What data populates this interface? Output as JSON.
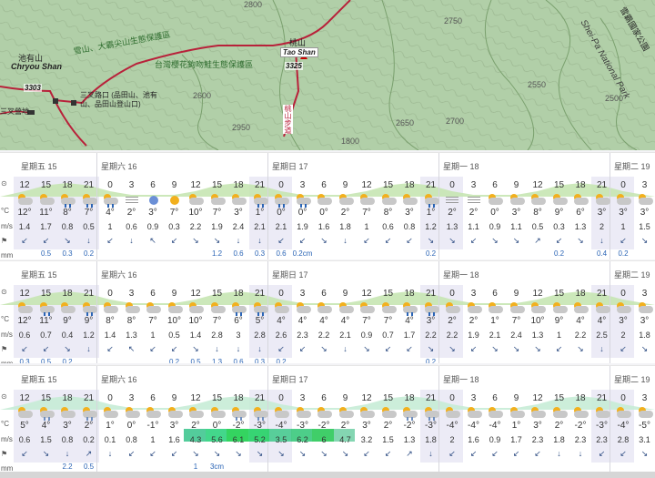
{
  "map": {
    "labels": {
      "chiyou_cn": "池有山",
      "chiyou_en": "Chryou Shan",
      "chiyou_height": "3303",
      "tao_cn": "桃山",
      "tao_en": "Tao Shan",
      "tao_height": "3325",
      "reserve1": "雪山、大霸尖山生態保護區",
      "reserve2": "台灣櫻花鉤吻鮭生態保護區",
      "junction": "三叉路口 (品田山、池有山、品田山登山口)",
      "camp": "三叉營地",
      "road": "桃山步道",
      "park": "Shei-Pa National Park",
      "park_cn": "雪霸國家公園"
    },
    "contours": [
      "1800",
      "2950",
      "2650",
      "2700",
      "2550",
      "2500",
      "2600",
      "2750",
      "2800"
    ]
  },
  "bands": [
    {
      "days": [
        "星期五 15",
        "星期六 16",
        "星期日 17",
        "星期一 18",
        "星期二 19"
      ],
      "hours": [
        "12",
        "15",
        "18",
        "21",
        "0",
        "3",
        "6",
        "9",
        "12",
        "15",
        "18",
        "21",
        "0",
        "3",
        "6",
        "9",
        "12",
        "15",
        "18",
        "21",
        "0",
        "3",
        "6",
        "9",
        "12",
        "15",
        "18",
        "21",
        "0",
        "3"
      ],
      "temps": [
        "12°",
        "11°",
        "8°",
        "7°",
        "4°",
        "2°",
        "3°",
        "7°",
        "10°",
        "7°",
        "3°",
        "1°",
        "0°",
        "0°",
        "0°",
        "2°",
        "7°",
        "8°",
        "3°",
        "1°",
        "2°",
        "2°",
        "0°",
        "3°",
        "8°",
        "9°",
        "6°",
        "3°",
        "3°",
        "3°"
      ],
      "winds": [
        "1.4",
        "1.7",
        "0.8",
        "0.5",
        "1",
        "0.6",
        "0.9",
        "0.3",
        "2.2",
        "1.9",
        "2.4",
        "2.1",
        "2.1",
        "1.9",
        "1.6",
        "1.8",
        "1",
        "0.6",
        "0.8",
        "1.2",
        "1.3",
        "1.1",
        "0.9",
        "1.1",
        "0.5",
        "0.3",
        "1.3",
        "2",
        "1",
        "1.5"
      ],
      "precip": [
        "",
        "0.5",
        "0.3",
        "0.2",
        "",
        "",
        "",
        "",
        "",
        "1.2",
        "0.6",
        "0.3",
        "0.6",
        "0.2cm",
        "",
        "",
        "",
        "",
        "",
        "0.2",
        "",
        "",
        "",
        "",
        "",
        "0.2",
        "",
        "0.4",
        "0.2",
        ""
      ],
      "wind_arrows": [
        "↙",
        "↙",
        "↘",
        "↓",
        "↙",
        "↓",
        "↖",
        "↙",
        "↘",
        "↘",
        "↓",
        "↓",
        "↙",
        "↙",
        "↘",
        "↓",
        "↙",
        "↙",
        "↙",
        "↘",
        "↘",
        "↙",
        "↘",
        "↘",
        "↗",
        "↙",
        "↘",
        "↓",
        "↙",
        "↘"
      ],
      "icons": [
        "pc",
        "pc",
        "rain",
        "rain",
        "rain",
        "fog",
        "moon",
        "sun",
        "pc",
        "pc",
        "pc",
        "rain",
        "rain",
        "rain",
        "pc",
        "pc",
        "pc",
        "pc",
        "pc",
        "rain",
        "fog",
        "fog",
        "pc",
        "pc",
        "pc",
        "pc",
        "pc",
        "pc",
        "pc",
        "pc"
      ]
    },
    {
      "days": [
        "星期五 15",
        "星期六 16",
        "星期日 17",
        "星期一 18",
        "星期二 19"
      ],
      "hours": [
        "12",
        "15",
        "18",
        "21",
        "0",
        "3",
        "6",
        "9",
        "12",
        "15",
        "18",
        "21",
        "0",
        "3",
        "6",
        "9",
        "12",
        "15",
        "18",
        "21",
        "0",
        "3",
        "6",
        "9",
        "12",
        "15",
        "18",
        "21",
        "0",
        "3"
      ],
      "temps": [
        "12°",
        "11°",
        "9°",
        "9°",
        "8°",
        "8°",
        "7°",
        "10°",
        "10°",
        "7°",
        "6°",
        "5°",
        "4°",
        "4°",
        "4°",
        "4°",
        "7°",
        "7°",
        "4°",
        "3°",
        "2°",
        "2°",
        "1°",
        "7°",
        "10°",
        "9°",
        "4°",
        "4°",
        "3°",
        "3°"
      ],
      "winds": [
        "0.6",
        "0.7",
        "0.4",
        "1.2",
        "1.4",
        "1.3",
        "1",
        "0.5",
        "1.4",
        "2.8",
        "3",
        "2.8",
        "2.6",
        "2.3",
        "2.2",
        "2.1",
        "0.9",
        "0.7",
        "1.7",
        "2.2",
        "2.2",
        "1.9",
        "2.1",
        "2.4",
        "1.3",
        "1",
        "2.2",
        "2.5",
        "2",
        "1.8"
      ],
      "precip": [
        "0.3",
        "0.5",
        "0.2",
        "",
        "",
        "",
        "",
        "0.2",
        "0.5",
        "1.3",
        "0.6",
        "0.3",
        "0.2",
        "",
        "",
        "",
        "",
        "",
        "",
        "0.2",
        "",
        "",
        "",
        "",
        "",
        "",
        "",
        "",
        "",
        ""
      ],
      "wind_arrows": [
        "↙",
        "↙",
        "↘",
        "↓",
        "↙",
        "↖",
        "↙",
        "↙",
        "↘",
        "↓",
        "↓",
        "↓",
        "↙",
        "↙",
        "↘",
        "↓",
        "↘",
        "↙",
        "↙",
        "↘",
        "↘",
        "↙",
        "↘",
        "↘",
        "↘",
        "↙",
        "↘",
        "↓",
        "↙",
        "↘"
      ],
      "icons": [
        "pc",
        "rain",
        "pc",
        "rain",
        "pc",
        "pc",
        "pc",
        "pc",
        "pc",
        "pc",
        "rain",
        "rain",
        "pc",
        "pc",
        "pc",
        "pc",
        "pc",
        "pc",
        "rain",
        "rain",
        "pc",
        "pc",
        "pc",
        "pc",
        "pc",
        "pc",
        "pc",
        "pc",
        "pc",
        "pc"
      ]
    },
    {
      "days": [
        "星期五 15",
        "星期六 16",
        "星期日 17",
        "星期一 18",
        "星期二 19"
      ],
      "hours": [
        "12",
        "15",
        "18",
        "21",
        "0",
        "3",
        "6",
        "9",
        "12",
        "15",
        "18",
        "21",
        "0",
        "3",
        "6",
        "9",
        "12",
        "15",
        "18",
        "21",
        "0",
        "3",
        "6",
        "9",
        "12",
        "15",
        "18",
        "21",
        "0",
        "3"
      ],
      "temps": [
        "5°",
        "4°",
        "3°",
        "2°",
        "1°",
        "0°",
        "-1°",
        "3°",
        "2°",
        "0°",
        "-2°",
        "-3°",
        "-4°",
        "-3°",
        "-2°",
        "2°",
        "3°",
        "2°",
        "-2°",
        "-3°",
        "-4°",
        "-4°",
        "-4°",
        "1°",
        "3°",
        "2°",
        "-2°",
        "-3°",
        "-4°",
        "-5°"
      ],
      "winds": [
        "0.6",
        "1.5",
        "0.8",
        "0.2",
        "0.1",
        "0.8",
        "1",
        "1.6",
        "4.3",
        "5.6",
        "6.1",
        "5.2",
        "3.5",
        "6.2",
        "6",
        "4.7",
        "3.2",
        "1.5",
        "1.3",
        "1.8",
        "2",
        "1.6",
        "0.9",
        "1.7",
        "2.3",
        "1.8",
        "2.3",
        "2.3",
        "2.8",
        "3.1"
      ],
      "precip": [
        "",
        "",
        "2.2",
        "0.5",
        "",
        "",
        "",
        "",
        "1",
        "3cm",
        "",
        "",
        "",
        "",
        "",
        "",
        "",
        "",
        "",
        "",
        "",
        "",
        "",
        "",
        "",
        "",
        "",
        "",
        "",
        ""
      ],
      "wind_arrows": [
        "↙",
        "↘",
        "↓",
        "↗",
        "↓",
        "↙",
        "↙",
        "↙",
        "↘",
        "↘",
        "↘",
        "↘",
        "↘",
        "↘",
        "↘",
        "↘",
        "↙",
        "↙",
        "↗",
        "↓",
        "↙",
        "↙",
        "↙",
        "↙",
        "↙",
        "↓",
        "↓",
        "↙",
        "↙",
        "↘"
      ],
      "icons": [
        "pc",
        "snow",
        "pc",
        "snow",
        "pc",
        "pc",
        "pc",
        "pc",
        "pc",
        "pc",
        "snow",
        "snow",
        "pc",
        "pc",
        "pc",
        "pc",
        "pc",
        "pc",
        "snow",
        "snow",
        "pc",
        "pc",
        "pc",
        "pc",
        "pc",
        "pc",
        "pc",
        "pc",
        "pc",
        "pc"
      ],
      "wind_highlight_from": 8,
      "wind_highlight_to": 16
    }
  ],
  "row_labels": {
    "clock": "⊙",
    "temp": "°C",
    "wind": "m/s",
    "dir": "⚑",
    "precip": "mm"
  }
}
